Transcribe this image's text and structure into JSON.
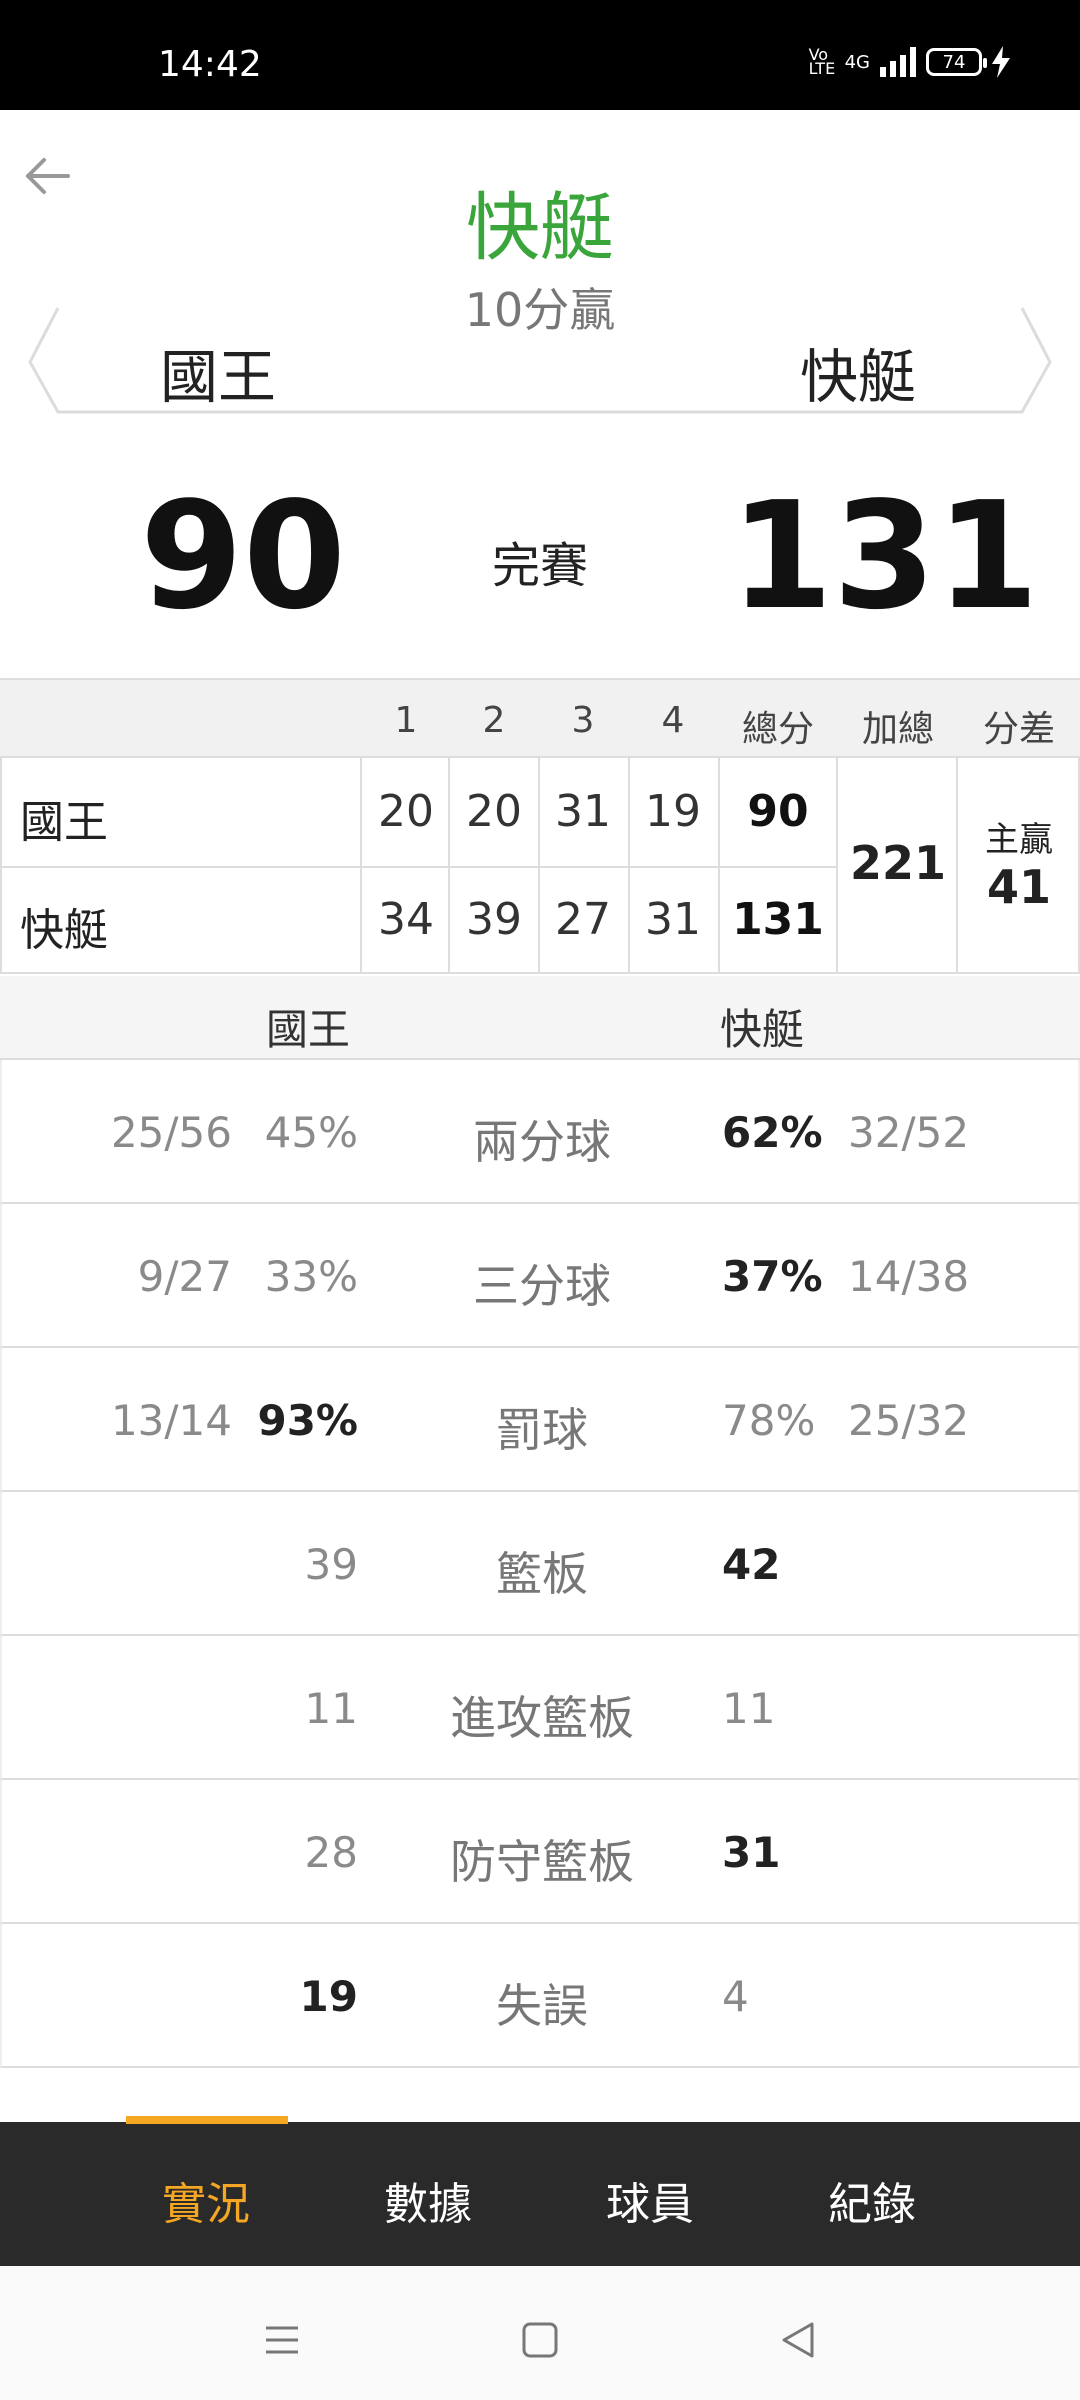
{
  "status_bar": {
    "time": "14:42",
    "volte_label": "Vo LTE",
    "network_label": "4G",
    "battery_level": "74",
    "charging": true
  },
  "header": {
    "winner_team": "快艇",
    "winner_margin": "10分贏",
    "home_team": "國王",
    "away_team": "快艇"
  },
  "score": {
    "home": "90",
    "away": "131",
    "state": "完賽"
  },
  "box_score": {
    "headers": [
      "1",
      "2",
      "3",
      "4",
      "總分",
      "加總",
      "分差"
    ],
    "rows": [
      {
        "team": "國王",
        "q": [
          "20",
          "20",
          "31",
          "19"
        ],
        "total": "90"
      },
      {
        "team": "快艇",
        "q": [
          "34",
          "39",
          "27",
          "31"
        ],
        "total": "131"
      }
    ],
    "combined_total": "221",
    "spread_label": "主贏",
    "spread_value": "41"
  },
  "comparison": {
    "home_team": "國王",
    "away_team": "快艇",
    "rows": [
      {
        "label": "兩分球",
        "home_frac": "25/56",
        "home_val": "45%",
        "away_val": "62%",
        "away_frac": "32/52",
        "leader": "away"
      },
      {
        "label": "三分球",
        "home_frac": "9/27",
        "home_val": "33%",
        "away_val": "37%",
        "away_frac": "14/38",
        "leader": "away"
      },
      {
        "label": "罰球",
        "home_frac": "13/14",
        "home_val": "93%",
        "away_val": "78%",
        "away_frac": "25/32",
        "leader": "home"
      },
      {
        "label": "籃板",
        "home_frac": "",
        "home_val": "39",
        "away_val": "42",
        "away_frac": "",
        "leader": "away"
      },
      {
        "label": "進攻籃板",
        "home_frac": "",
        "home_val": "11",
        "away_val": "11",
        "away_frac": "",
        "leader": "none"
      },
      {
        "label": "防守籃板",
        "home_frac": "",
        "home_val": "28",
        "away_val": "31",
        "away_frac": "",
        "leader": "away"
      },
      {
        "label": "失誤",
        "home_frac": "",
        "home_val": "19",
        "away_val": "4",
        "away_frac": "",
        "leader": "home"
      }
    ]
  },
  "tabs": [
    {
      "label": "實況",
      "active": true
    },
    {
      "label": "數據",
      "active": false
    },
    {
      "label": "球員",
      "active": false
    },
    {
      "label": "紀錄",
      "active": false
    }
  ],
  "colors": {
    "winner": "#3aa53a",
    "tab_active": "#f5a623",
    "tab_bar": "#2a2a2a"
  },
  "icons": {
    "back": "back-arrow-icon",
    "menu": "menu-lines-icon",
    "home": "square-home-icon",
    "back_nav": "triangle-back-icon"
  }
}
